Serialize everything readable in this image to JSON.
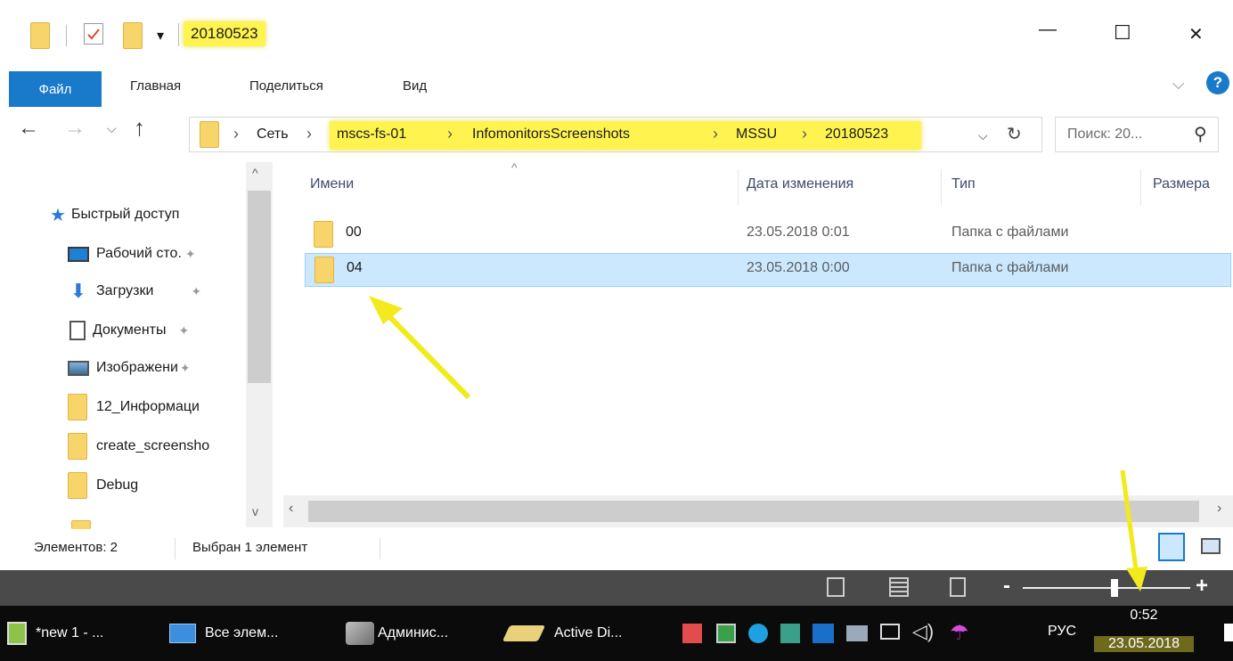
{
  "title": {
    "qat_dropdown": "▾",
    "folder_name": "20180523",
    "minimize": "—",
    "maximize": "☐",
    "close": "✕"
  },
  "ribbon": {
    "tabs": [
      "Файл",
      "Главная",
      "Поделиться",
      "Вид"
    ],
    "collapse": "⌵",
    "help": "?"
  },
  "address": {
    "back": "←",
    "forward": "→",
    "recent": "⌵",
    "up": "↑",
    "crumbs": [
      "Сеть",
      "mscs-fs-01",
      "InfomonitorsScreenshots",
      "MSSU",
      "20180523"
    ],
    "separator": "›",
    "dropdown": "⌵",
    "refresh": "↻",
    "search_placeholder": "Поиск: 20...",
    "search_icon": "⚲"
  },
  "nav": {
    "items": [
      {
        "label": "Быстрый доступ",
        "icon": "star-icon",
        "pinned": false
      },
      {
        "label": "Рабочий сто.",
        "icon": "desktop-icon",
        "pinned": true
      },
      {
        "label": "Загрузки",
        "icon": "download-icon",
        "pinned": true
      },
      {
        "label": "Документы",
        "icon": "documents-icon",
        "pinned": true
      },
      {
        "label": "Изображени",
        "icon": "pictures-icon",
        "pinned": true
      },
      {
        "label": "12_Информаци",
        "icon": "folder-icon",
        "pinned": false
      },
      {
        "label": "create_screensho",
        "icon": "folder-icon",
        "pinned": false
      },
      {
        "label": "Debug",
        "icon": "folder-icon",
        "pinned": false
      }
    ],
    "pin": "✦"
  },
  "list": {
    "sort_caret": "^",
    "headers": [
      "Имени",
      "Дата изменения",
      "Тип",
      "Размера"
    ],
    "rows": [
      {
        "name": "00",
        "date": "23.05.2018 0:01",
        "type": "Папка с файлами",
        "selected": false
      },
      {
        "name": "04",
        "date": "23.05.2018 0:00",
        "type": "Папка с файлами",
        "selected": true
      }
    ]
  },
  "status": {
    "count": "Элементов: 2",
    "selection": "Выбран 1 элемент"
  },
  "zoombar": {
    "minus": "-",
    "plus": "+",
    "level": 0.55
  },
  "taskbar": {
    "items": [
      {
        "label": "*new 1 - ...",
        "icon": "notepad-icon"
      },
      {
        "label": "Все элем...",
        "icon": "control-panel-icon"
      },
      {
        "label": "Админис...",
        "icon": "admin-tools-icon"
      },
      {
        "label": "Active Di...",
        "icon": "active-directory-icon"
      }
    ],
    "language": "РУС",
    "time": "0:52",
    "date": "23.05.2018"
  },
  "colors": {
    "accent": "#1979ca",
    "highlight": "#fff44f",
    "selection": "#cce8ff",
    "folder": "#f7d56b"
  }
}
